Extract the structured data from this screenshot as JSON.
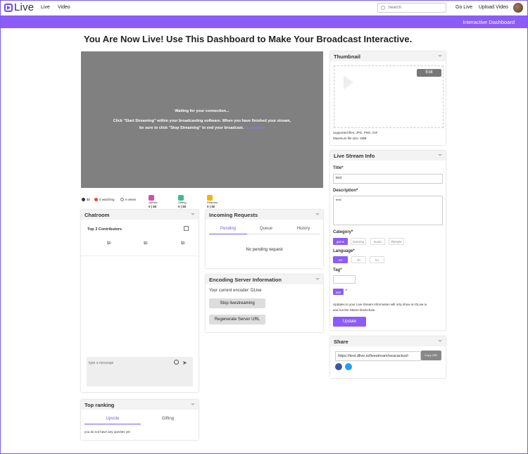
{
  "nav": {
    "logo_text": "Live",
    "links": [
      "Live",
      "Video"
    ],
    "search_placeholder": "Search",
    "go_live": "Go Live",
    "upload_video": "Upload Video"
  },
  "subbar": {
    "label": "Interactive Dashboard"
  },
  "headline": "You Are Now Live! Use This Dashboard to Make Your Broadcast Interactive.",
  "video": {
    "line1": "Waiting for your connection...",
    "line2": "Click \"Start Streaming\" within your broadcasting software. When you have finished your stream,",
    "line3": "be sure to click \"Stop Streaming\" to end your broadcast.",
    "learn_more": "Learn More"
  },
  "stats": {
    "earnings": "$0",
    "watching": "0 watching",
    "views": "0 views",
    "upvote_label": "Upvote",
    "upvote_value": "0 | $0",
    "gifting_label": "Gifting",
    "gifting_value": "0 | $0",
    "request_label": "Request",
    "request_value": "0 | $0"
  },
  "chatroom": {
    "title": "Chatroom",
    "top_contributors": "Top 3 Contributors",
    "contributor_values": [
      "$0",
      "$0",
      "$0"
    ],
    "message_placeholder": "type a message"
  },
  "top_ranking": {
    "title": "Top ranking",
    "tabs": [
      "Upvote",
      "Gifting"
    ],
    "empty": "you do not have any upvotes yet"
  },
  "incoming": {
    "title": "Incoming Requests",
    "tabs": [
      "Pending",
      "Queue",
      "History"
    ],
    "empty": "No pending request"
  },
  "encoding": {
    "title": "Encoding Server Information",
    "current": "Your current encoder: DLive",
    "stop_btn": "Stop livestreaming",
    "regen_btn": "Regenerate Server URL"
  },
  "thumbnail": {
    "title": "Thumbnail",
    "edit_btn": "Edit",
    "supported": "Supported files: JPG, PNG, GIF",
    "max_size": "Maximum file size: 2MB"
  },
  "stream_info": {
    "title": "Live Stream Info",
    "title_label": "Title*",
    "title_value": "test",
    "desc_label": "Description*",
    "desc_value": "best",
    "category_label": "Category*",
    "categories": [
      "game",
      "learning",
      "music",
      "lifestyle"
    ],
    "language_label": "Language*",
    "languages": [
      "en",
      "zh",
      "ko"
    ],
    "tag_label": "Tag*",
    "tag_chip": "test",
    "tag_remove": "×",
    "note1": "Updates to your Live Stream Information will only show on DLive.io",
    "note2": "and not the Steem blockchain.",
    "update_btn": "Update"
  },
  "share": {
    "title": "Share",
    "url": "https://test.dlive.io/livestream/seacactus/r",
    "copy_btn": "Copy URL"
  },
  "colors": {
    "accent": "#8b5cf6",
    "video_bg": "#808080"
  }
}
